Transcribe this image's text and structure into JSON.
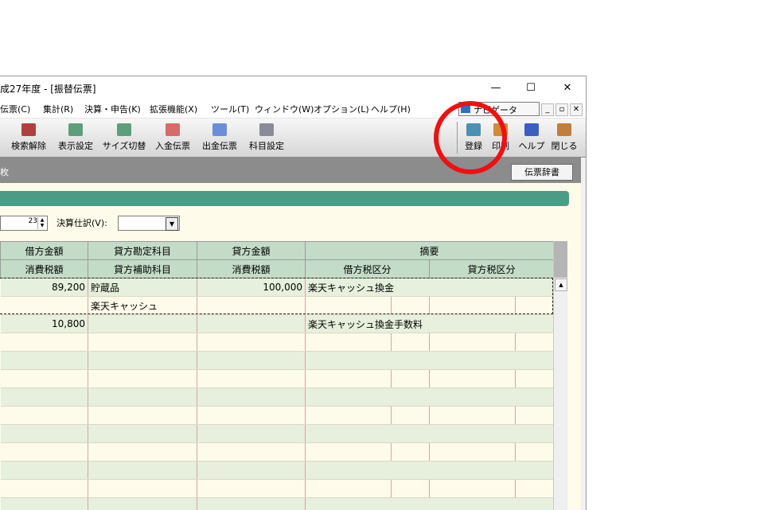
{
  "window": {
    "title": "成27年度 - [振替伝票]",
    "minimize": "—",
    "maximize": "☐",
    "close": "✕"
  },
  "menu": {
    "items": [
      "伝票(C)",
      "集計(R)",
      "決算・申告(K)",
      "拡張機能(X)",
      "ツール(T)",
      "ウィンドウ(W)",
      "オプション(L)",
      "ヘルプ(H)"
    ],
    "navigator": "ナビゲータ",
    "mdi": [
      "_",
      "▫",
      "✕"
    ]
  },
  "toolbar": {
    "buttons": [
      {
        "label": "検索解除",
        "icon": "search-clear-icon",
        "color": "#b04040"
      },
      {
        "label": "表示設定",
        "icon": "display-settings-icon",
        "color": "#5e9e7a"
      },
      {
        "label": "サイズ切替",
        "icon": "resize-icon",
        "color": "#5e9e7a"
      },
      {
        "label": "入金伝票",
        "icon": "deposit-slip-icon",
        "color": "#d76a6a"
      },
      {
        "label": "出金伝票",
        "icon": "withdrawal-slip-icon",
        "color": "#6a8fd7"
      },
      {
        "label": "科目設定",
        "icon": "account-settings-icon",
        "color": "#8a8a9a"
      },
      {
        "label": "登録",
        "icon": "register-icon",
        "color": "#4d8fb5"
      },
      {
        "label": "印刷",
        "icon": "print-icon",
        "color": "#d08a3a"
      },
      {
        "label": "ヘルプ",
        "icon": "help-icon",
        "color": "#3a5fc0"
      },
      {
        "label": "閉じる",
        "icon": "close-door-icon",
        "color": "#c0803a"
      }
    ]
  },
  "subheader": {
    "left_fragment": "枚",
    "dict_button": "伝票辞書"
  },
  "form": {
    "spin_value": "23",
    "kessan_label": "決算仕訳(V):",
    "kessan_value": ""
  },
  "grid": {
    "header_row1": [
      "借方金額",
      "貸方勘定科目",
      "貸方金額",
      "摘要"
    ],
    "header_row2": [
      "消費税額",
      "貸方補助科目",
      "消費税額",
      "借方税区分",
      "貸方税区分"
    ],
    "rows": [
      {
        "debit": "89,200",
        "credit_account": "貯蔵品",
        "credit_amount": "100,000",
        "memo": "楽天キャッシュ換金"
      },
      {
        "debit": "",
        "credit_account": "楽天キャッシュ",
        "credit_amount": "",
        "memo": ""
      },
      {
        "debit": "10,800",
        "credit_account": "",
        "credit_amount": "",
        "memo": "楽天キャッシュ換金手数料"
      },
      {
        "debit": "",
        "credit_account": "",
        "credit_amount": "",
        "memo": ""
      },
      {
        "debit": "",
        "credit_account": "",
        "credit_amount": "",
        "memo": ""
      },
      {
        "debit": "",
        "credit_account": "",
        "credit_amount": "",
        "memo": ""
      },
      {
        "debit": "",
        "credit_account": "",
        "credit_amount": "",
        "memo": ""
      },
      {
        "debit": "",
        "credit_account": "",
        "credit_amount": "",
        "memo": ""
      },
      {
        "debit": "",
        "credit_account": "",
        "credit_amount": "",
        "memo": ""
      },
      {
        "debit": "",
        "credit_account": "",
        "credit_amount": "",
        "memo": ""
      },
      {
        "debit": "",
        "credit_account": "",
        "credit_amount": "",
        "memo": ""
      },
      {
        "debit": "",
        "credit_account": "",
        "credit_amount": "",
        "memo": ""
      },
      {
        "debit": "",
        "credit_account": "",
        "credit_amount": "",
        "memo": ""
      }
    ]
  },
  "annotation": {
    "color": "#ee1111",
    "target": "登録"
  }
}
